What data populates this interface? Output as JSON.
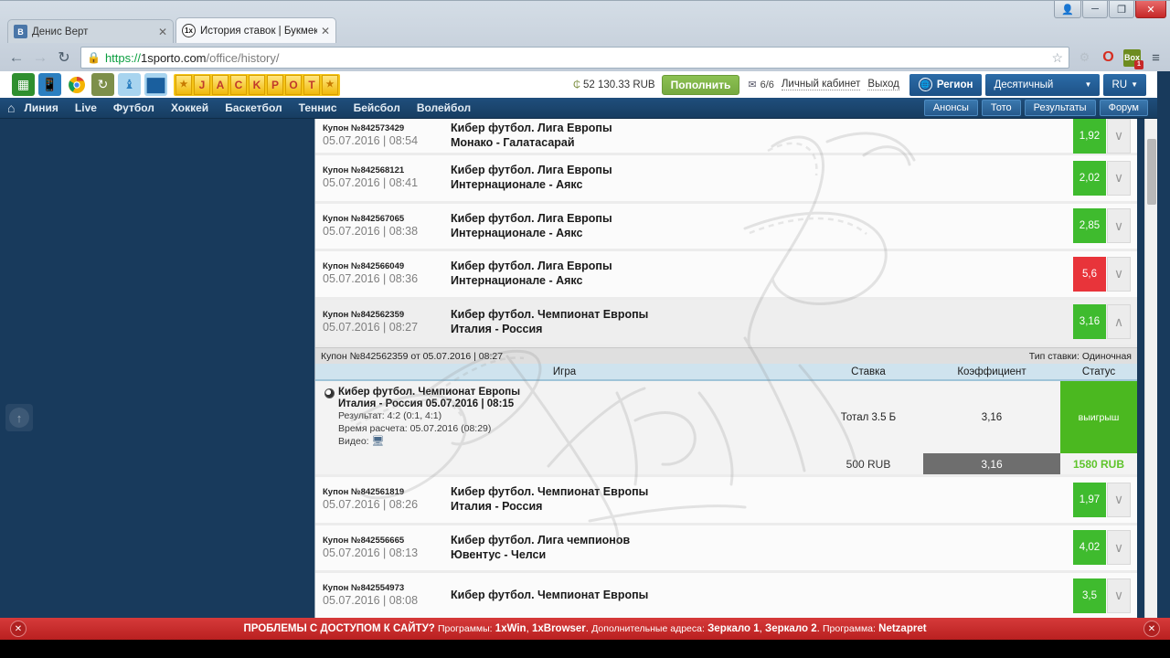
{
  "browser": {
    "tabs": [
      {
        "favicon": "vk-icon",
        "title": "Денис Верт",
        "active": false
      },
      {
        "favicon": "1x-icon",
        "title": "История ставок | Букмек",
        "active": true
      }
    ],
    "window_controls": {
      "user": "□",
      "minimize": "—",
      "restore": "❐",
      "close": "✕"
    },
    "nav": {
      "back": "←",
      "forward": "→",
      "reload": "↻"
    },
    "address": {
      "lock": "🔒",
      "scheme": "https://",
      "host": "1sporto.com",
      "path": "/office/history/",
      "star": "☆"
    },
    "extensions": [
      {
        "name": "opera-extension-icon",
        "glyph": "O"
      },
      {
        "name": "box-extension-icon",
        "glyph": "Box",
        "badge": "1"
      },
      {
        "name": "chrome-menu-icon",
        "glyph": "≡"
      }
    ]
  },
  "site_header": {
    "icons": [
      {
        "name": "windows-app-icon",
        "glyph": "⊞"
      },
      {
        "name": "mobile-app-icon",
        "glyph": "▯"
      },
      {
        "name": "chrome-extension-icon",
        "glyph": "◉"
      },
      {
        "name": "headset-support-icon",
        "glyph": "↻"
      },
      {
        "name": "bird-icon",
        "glyph": "♈"
      },
      {
        "name": "statistics-icon",
        "glyph": "█"
      }
    ],
    "jackpot_letters": [
      "★",
      "J",
      "A",
      "C",
      "K",
      "P",
      "O",
      "T",
      "★"
    ],
    "balance": "52 130.33 RUB",
    "balance_icon": "₵",
    "topup_label": "Пополнить",
    "mail_icon": "✉",
    "mail_count": "6/6",
    "account_link": "Личный кабинет",
    "logout_link": "Выход",
    "region_label": "Регион",
    "region_icon": "globe-icon",
    "odds_format": "Десятичный",
    "language": "RU",
    "caret": "▼"
  },
  "site_nav": {
    "home_icon": "⌂",
    "items": [
      "Линия",
      "Live",
      "Футбол",
      "Хоккей",
      "Баскетбол",
      "Теннис",
      "Бейсбол",
      "Волейбол"
    ],
    "right_items": [
      "Анонсы",
      "Тото",
      "Результаты",
      "Форум"
    ]
  },
  "sidebar": {
    "scroll_top_icon": "↑"
  },
  "bets": [
    {
      "coupon": "Купон №842573429",
      "date": "05.07.2016 | 08:54",
      "league": "Кибер футбол. Лига Европы",
      "teams": "Монако - Галатасарай",
      "odd": "1,92",
      "status": "win",
      "toggle": "∨",
      "expanded": false
    },
    {
      "coupon": "Купон №842568121",
      "date": "05.07.2016 | 08:41",
      "league": "Кибер футбол. Лига Европы",
      "teams": "Интернационале - Аякс",
      "odd": "2,02",
      "status": "win",
      "toggle": "∨",
      "expanded": false
    },
    {
      "coupon": "Купон №842567065",
      "date": "05.07.2016 | 08:38",
      "league": "Кибер футбол. Лига Европы",
      "teams": "Интернационале - Аякс",
      "odd": "2,85",
      "status": "win",
      "toggle": "∨",
      "expanded": false
    },
    {
      "coupon": "Купон №842566049",
      "date": "05.07.2016 | 08:36",
      "league": "Кибер футбол. Лига Европы",
      "teams": "Интернационале - Аякс",
      "odd": "5,6",
      "status": "lose",
      "toggle": "∨",
      "expanded": false
    },
    {
      "coupon": "Купон №842562359",
      "date": "05.07.2016 | 08:27",
      "league": "Кибер футбол. Чемпионат Европы",
      "teams": "Италия - Россия",
      "odd": "3,16",
      "status": "win",
      "toggle": "∧",
      "expanded": true
    },
    {
      "coupon": "Купон №842561819",
      "date": "05.07.2016 | 08:26",
      "league": "Кибер футбол. Чемпионат Европы",
      "teams": "Италия - Россия",
      "odd": "1,97",
      "status": "win",
      "toggle": "∨",
      "expanded": false
    },
    {
      "coupon": "Купон №842556665",
      "date": "05.07.2016 | 08:13",
      "league": "Кибер футбол. Лига чемпионов",
      "teams": "Ювентус - Челси",
      "odd": "4,02",
      "status": "win",
      "toggle": "∨",
      "expanded": false
    },
    {
      "coupon": "Купон №842554973",
      "date": "05.07.2016 | 08:08",
      "league": "Кибер футбол. Чемпионат Европы",
      "teams": "",
      "odd": "3,5",
      "status": "win",
      "toggle": "∨",
      "expanded": false
    }
  ],
  "coupon_detail": {
    "header": "Купон №842562359 от 05.07.2016 | 08:27",
    "bet_type": "Тип ставки: Одиночная",
    "columns": {
      "game": "Игра",
      "stake": "Ставка",
      "coefficient": "Коэффициент",
      "status": "Статус"
    },
    "row": {
      "league": "Кибер футбол. Чемпионат Европы",
      "match": "Италия - Россия 05.07.2016 | 08:15",
      "result": "Результат: 4:2 (0:1, 4:1)",
      "calc_time": "Время расчета: 05.07.2016 (08:29)",
      "video_label": "Видео:",
      "video_icon": "🖵",
      "stake_market": "Тотал 3.5 Б",
      "coefficient": "3,16",
      "status": "выигрыш"
    },
    "footer": {
      "stake": "500 RUB",
      "coefficient": "3,16",
      "winnings": "1580 RUB"
    }
  },
  "watermark": {
    "text": "Денис Верт"
  },
  "red_banner": {
    "lead": "ПРОБЛЕМЫ С ДОСТУПОМ К САЙТУ?",
    "programs_label": "Программы:",
    "program_1": "1xWin",
    "program_2": "1xBrowser",
    "addr_label": "Дополнительные адреса:",
    "mirror_1": "Зеркало 1",
    "mirror_2": "Зеркало 2",
    "prog_label": "Программа:",
    "prog_name": "Netzapret",
    "close_icon": "✕"
  },
  "colors": {
    "accent_blue": "#1d5186",
    "nav_dark": "#183a5c",
    "win_green": "#3fbb2e",
    "lose_red": "#e8343a",
    "banner_red": "#b92020",
    "topup_green": "#8cc152"
  }
}
